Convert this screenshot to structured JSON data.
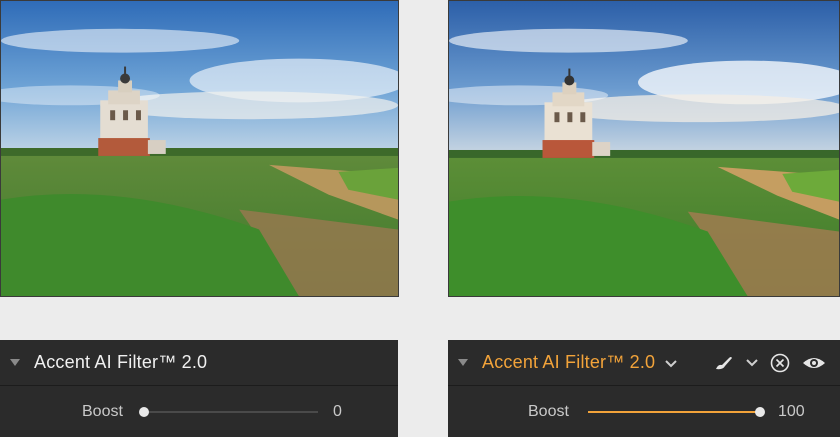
{
  "left_panel": {
    "title": "Accent AI Filter™ 2.0",
    "slider": {
      "label": "Boost",
      "value": "0",
      "fraction": 0
    }
  },
  "right_panel": {
    "title": "Accent AI Filter™ 2.0",
    "slider": {
      "label": "Boost",
      "value": "100",
      "fraction": 1
    },
    "icons": [
      "brush-icon",
      "chevron-down-icon",
      "close-circle-icon",
      "eye-icon"
    ]
  },
  "colors": {
    "accent": "#f2a33a",
    "panel_bg": "#2b2b2b"
  }
}
